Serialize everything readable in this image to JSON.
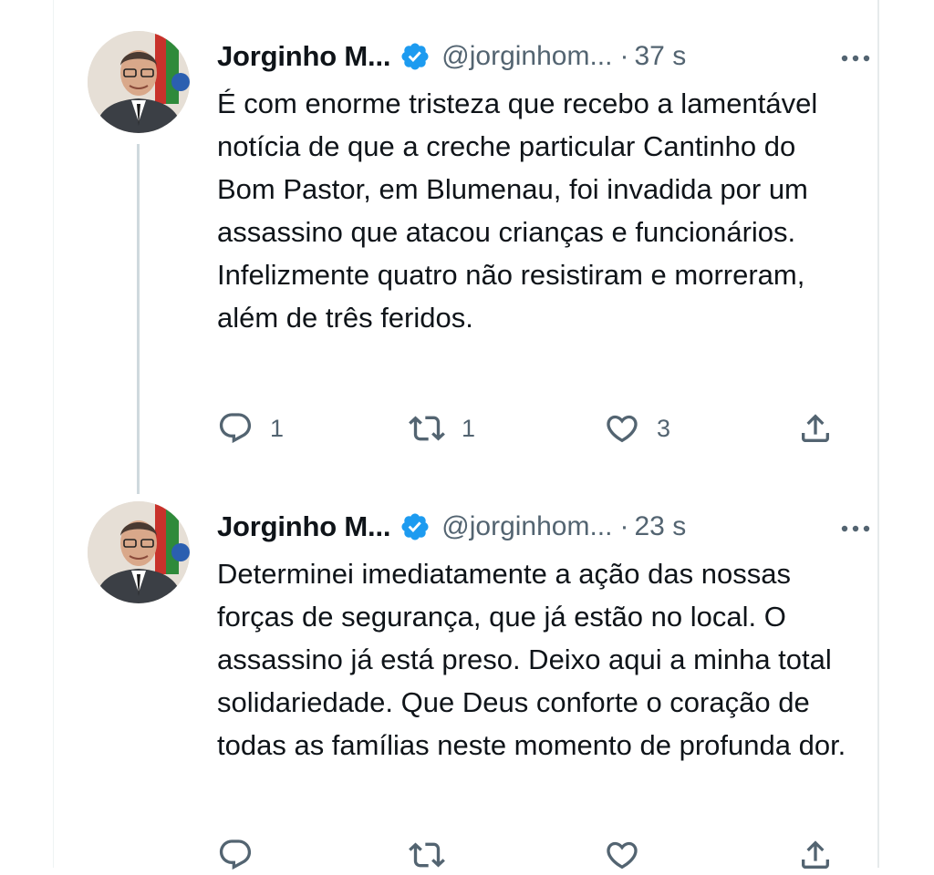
{
  "colors": {
    "verified_badge": "#1d9bf0",
    "text_primary": "#0f1419",
    "text_secondary": "#536471",
    "thread_line": "#cfd9de"
  },
  "tweets": [
    {
      "name": "Jorginho M...",
      "handle": "@jorginhom...",
      "separator": "·",
      "time": "37 s",
      "text": "É com enorme tristeza que recebo a lamentável notícia de que a creche particular Cantinho do Bom Pastor, em Blumenau, foi invadida por um assassino que atacou crianças e funcionários. Infelizmente quatro não resistiram e morreram, além de três feridos.",
      "reply_count": "1",
      "retweet_count": "1",
      "like_count": "3",
      "icons": {
        "verified": "verified-badge-icon",
        "more": "more-icon",
        "reply": "reply-icon",
        "retweet": "retweet-icon",
        "like": "heart-icon",
        "share": "share-icon"
      }
    },
    {
      "name": "Jorginho M...",
      "handle": "@jorginhom...",
      "separator": "·",
      "time": "23 s",
      "text": "Determinei imediatamente a ação das nossas forças de segurança, que já estão no local. O assassino já está preso. Deixo aqui a minha total solidariedade. Que Deus conforte o coração de todas as famílias neste momento de profunda dor.",
      "icons": {
        "verified": "verified-badge-icon",
        "more": "more-icon",
        "reply": "reply-icon",
        "retweet": "retweet-icon",
        "like": "heart-icon",
        "share": "share-icon"
      }
    }
  ]
}
